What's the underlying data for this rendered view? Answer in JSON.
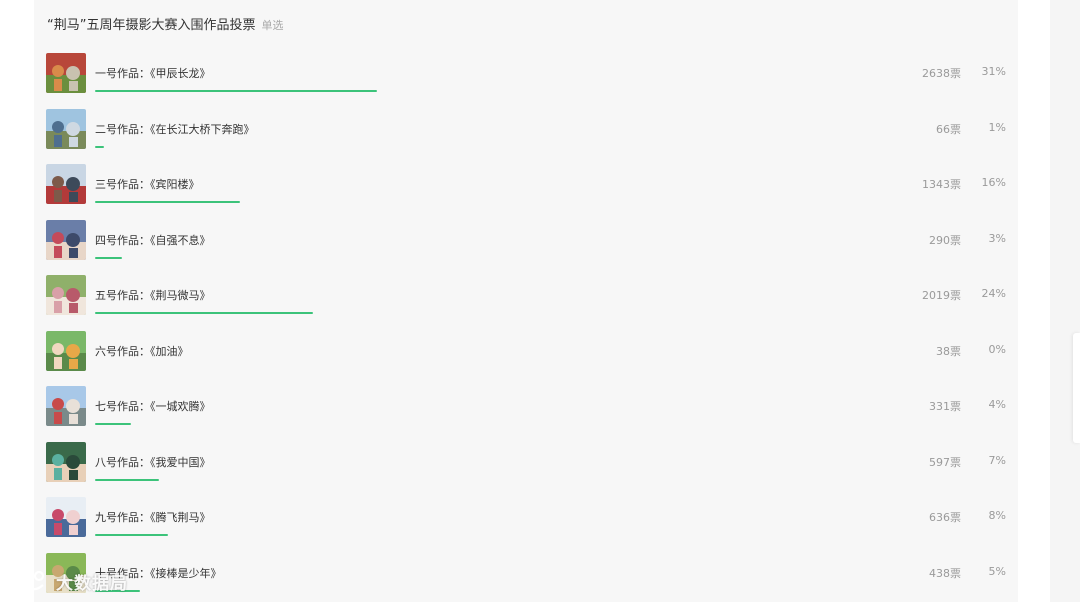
{
  "poll": {
    "title": "“荆马”五周年摄影大赛入围作品投票",
    "tag": "单选",
    "items": [
      {
        "label": "一号作品：《甲辰长龙》",
        "votes": "2638票",
        "percent": "31%",
        "fraction": 0.31,
        "thumb_icon": "photo-marathon-crowd"
      },
      {
        "label": "二号作品：《在长江大桥下奔跑》",
        "votes": "66票",
        "percent": "1%",
        "fraction": 0.01,
        "thumb_icon": "photo-bridge"
      },
      {
        "label": "三号作品：《宾阳楼》",
        "votes": "1343票",
        "percent": "16%",
        "fraction": 0.16,
        "thumb_icon": "photo-tower"
      },
      {
        "label": "四号作品：《自强不息》",
        "votes": "290票",
        "percent": "3%",
        "fraction": 0.03,
        "thumb_icon": "photo-runners"
      },
      {
        "label": "五号作品：《荆马微马》",
        "votes": "2019票",
        "percent": "24%",
        "fraction": 0.24,
        "thumb_icon": "photo-runners-group"
      },
      {
        "label": "六号作品：《加油》",
        "votes": "38票",
        "percent": "0%",
        "fraction": 0.0,
        "thumb_icon": "photo-cheer"
      },
      {
        "label": "七号作品：《一城欢腾》",
        "votes": "331票",
        "percent": "4%",
        "fraction": 0.04,
        "thumb_icon": "photo-city"
      },
      {
        "label": "八号作品：《我爱中国》",
        "votes": "597票",
        "percent": "7%",
        "fraction": 0.07,
        "thumb_icon": "photo-portrait"
      },
      {
        "label": "九号作品：《腾飞荆马》",
        "votes": "636票",
        "percent": "8%",
        "fraction": 0.08,
        "thumb_icon": "photo-race"
      },
      {
        "label": "十号作品：《接棒是少年》",
        "votes": "438票",
        "percent": "5%",
        "fraction": 0.05,
        "thumb_icon": "photo-youth"
      }
    ]
  },
  "watermark": {
    "text": "大数据局"
  },
  "colors": {
    "bar": "#3cc37a",
    "card_bg": "#f7f7f7",
    "muted_text": "#9a9a9a"
  }
}
